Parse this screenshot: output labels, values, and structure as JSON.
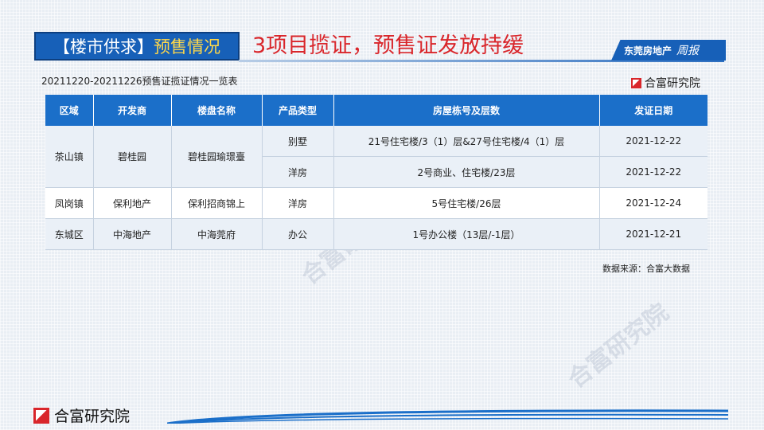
{
  "header": {
    "tag_bracket_open": "【楼市供求】",
    "tag_sub": "预售情况",
    "headline": "3项目揽证，预售证发放持缓",
    "brand_name": "东莞房地产",
    "brand_script": "周报"
  },
  "subtitle": "20211220-20211226预售证揽证情况一览表",
  "logo_text": "合富研究院",
  "table": {
    "headers": [
      "区域",
      "开发商",
      "楼盘名称",
      "产品类型",
      "房屋栋号及层数",
      "发证日期"
    ],
    "rows": [
      {
        "region": "茶山镇",
        "developer": "碧桂园",
        "project": "碧桂园瑜璟臺",
        "type": "别墅",
        "building": "21号住宅楼/3（1）层&27号住宅楼/4（1）层",
        "date": "2021-12-22"
      },
      {
        "type": "洋房",
        "building": "2号商业、住宅楼/23层",
        "date": "2021-12-22"
      },
      {
        "region": "凤岗镇",
        "developer": "保利地产",
        "project": "保利招商锦上",
        "type": "洋房",
        "building": "5号住宅楼/26层",
        "date": "2021-12-24"
      },
      {
        "region": "东城区",
        "developer": "中海地产",
        "project": "中海莞府",
        "type": "办公",
        "building": "1号办公楼（13层/-1层）",
        "date": "2021-12-21"
      }
    ]
  },
  "source": "数据来源：合富大数据",
  "watermark": "合富研究院",
  "footer": {
    "logo_text": "合富研究院"
  },
  "colors": {
    "primary_blue": "#1760b8",
    "header_blue": "#1b6fc9",
    "headline_red": "#d9262b",
    "tag_yellow": "#ffd84a"
  }
}
